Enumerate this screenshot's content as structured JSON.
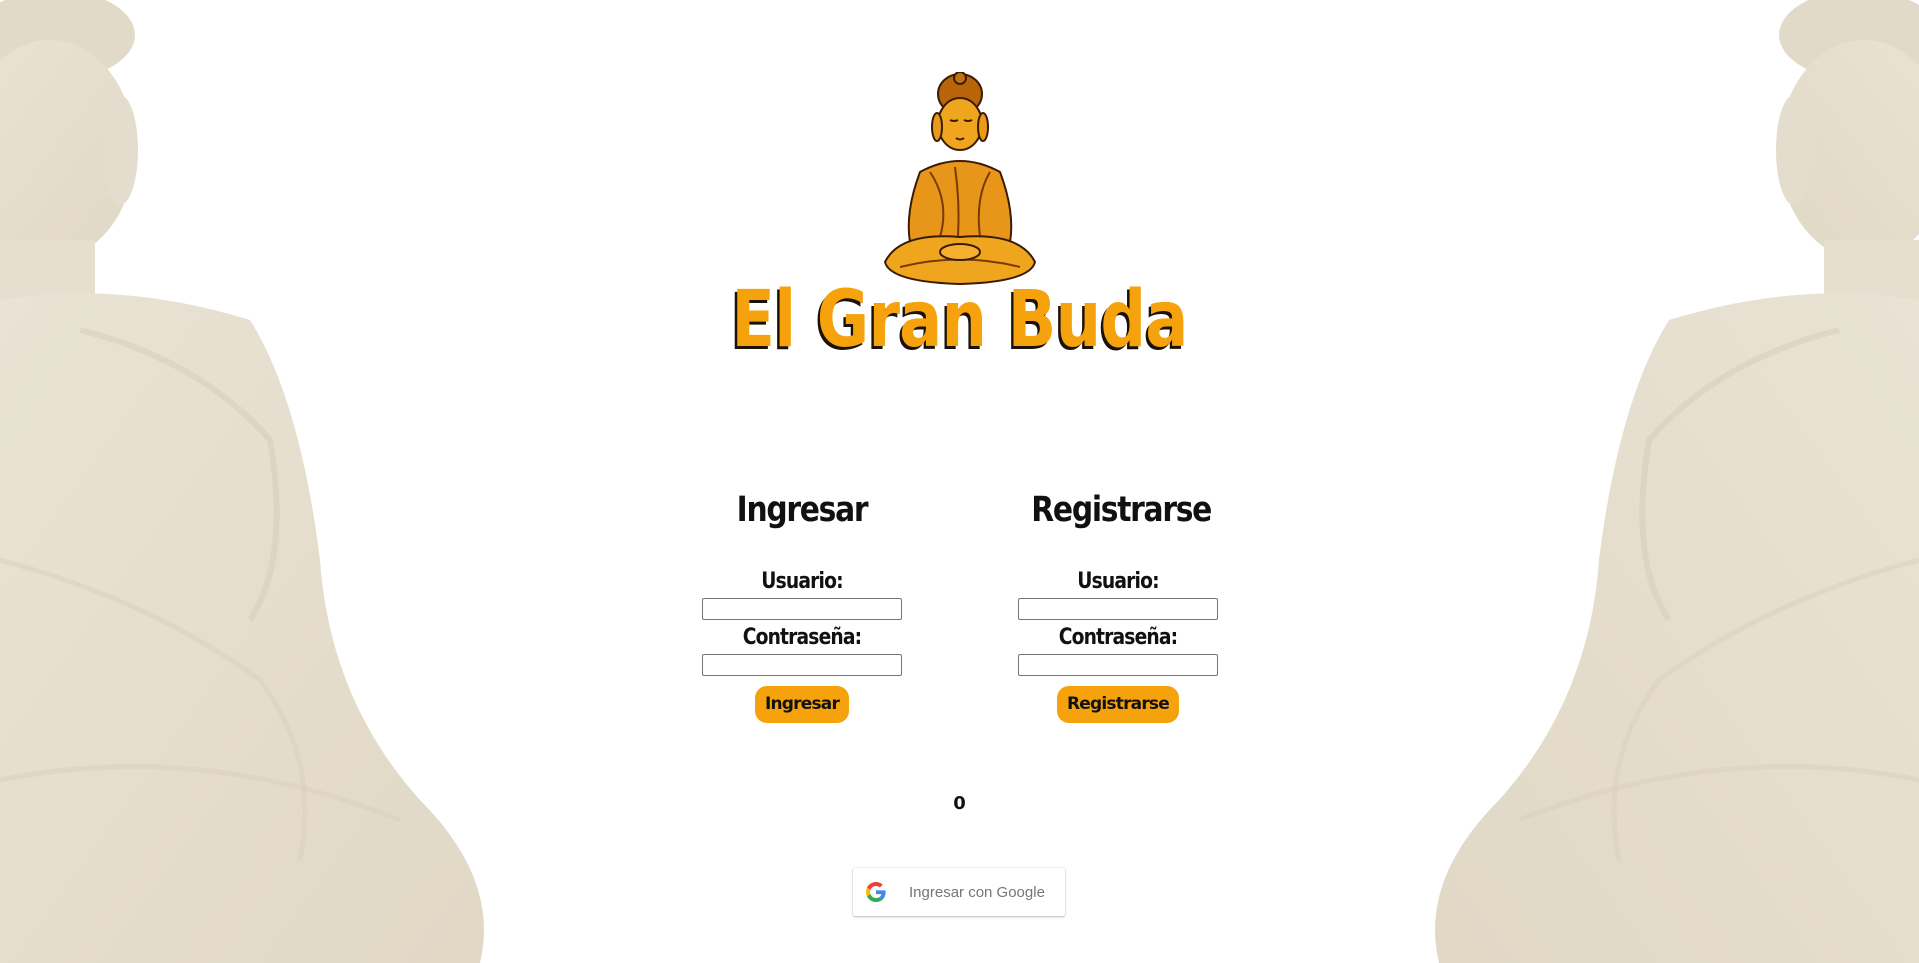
{
  "brand": {
    "title": "El Gran Buda",
    "logo_icon": "buddha-icon",
    "accent_color": "#f5a20d"
  },
  "login": {
    "heading": "Ingresar",
    "user_label": "Usuario:",
    "password_label": "Contraseña:",
    "user_value": "",
    "password_value": "",
    "submit_label": "Ingresar"
  },
  "register": {
    "heading": "Registrarse",
    "user_label": "Usuario:",
    "password_label": "Contraseña:",
    "user_value": "",
    "password_value": "",
    "submit_label": "Registrarse"
  },
  "counter": "0",
  "google": {
    "label": "Ingresar con Google",
    "icon": "google-icon"
  },
  "background": {
    "left_icon": "buddha-statue-icon",
    "right_icon": "buddha-statue-icon"
  }
}
